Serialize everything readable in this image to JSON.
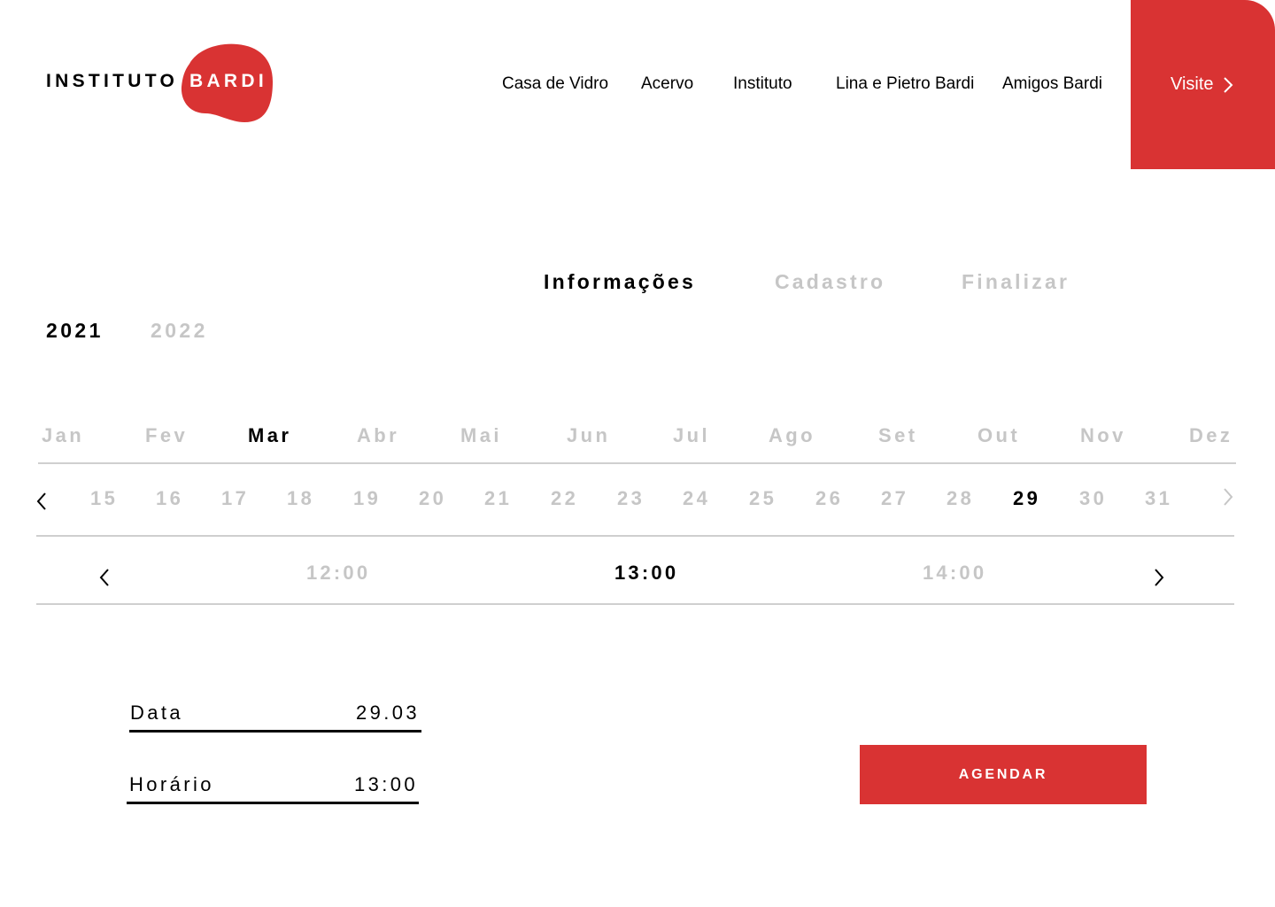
{
  "brand": {
    "name_part1": "INSTITUTO",
    "name_part2": "BARDI",
    "accent_color": "#d93333"
  },
  "nav": {
    "items": [
      {
        "label": "Casa de Vidro"
      },
      {
        "label": "Acervo"
      },
      {
        "label": "Instituto"
      },
      {
        "label": "Lina e Pietro Bardi"
      },
      {
        "label": "Amigos Bardi"
      }
    ],
    "visit_label": "Visite",
    "visit_icon": "chevron-right-icon"
  },
  "steps": [
    {
      "label": "Informações",
      "active": true
    },
    {
      "label": "Cadastro",
      "active": false
    },
    {
      "label": "Finalizar",
      "active": false
    }
  ],
  "years": [
    {
      "label": "2021",
      "selected": true
    },
    {
      "label": "2022",
      "selected": false
    }
  ],
  "months": [
    "Jan",
    "Fev",
    "Mar",
    "Abr",
    "Mai",
    "Jun",
    "Jul",
    "Ago",
    "Set",
    "Out",
    "Nov",
    "Dez"
  ],
  "selected_month": "Mar",
  "days": [
    "15",
    "16",
    "17",
    "18",
    "19",
    "20",
    "21",
    "22",
    "23",
    "24",
    "25",
    "26",
    "27",
    "28",
    "29",
    "30",
    "31"
  ],
  "selected_day": "29",
  "times": [
    "12:00",
    "13:00",
    "14:00"
  ],
  "selected_time": "13:00",
  "summary": {
    "date_label": "Data",
    "date_value": "29.03",
    "time_label": "Horário",
    "time_value": "13:00"
  },
  "cta_label": "AGENDAR"
}
